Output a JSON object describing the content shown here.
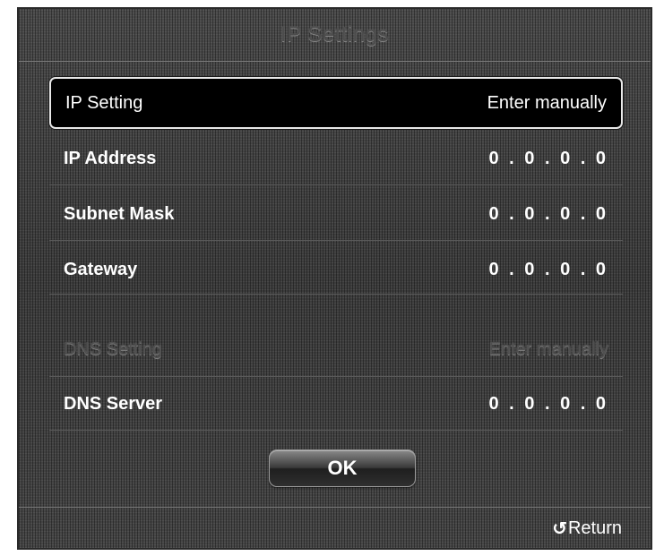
{
  "dialog": {
    "title": "IP Settings"
  },
  "settings": [
    {
      "label": "IP Setting",
      "value": "Enter manually"
    },
    {
      "label": "IP Address",
      "value": "0 . 0 . 0 . 0"
    },
    {
      "label": "Subnet Mask",
      "value": "0 . 0 . 0 . 0"
    },
    {
      "label": "Gateway",
      "value": "0 . 0 . 0 . 0"
    },
    {
      "label": "DNS Setting",
      "value": "Enter manually"
    },
    {
      "label": "DNS Server",
      "value": "0 . 0 . 0 . 0"
    }
  ],
  "ok_button": {
    "label": "OK"
  },
  "footer": {
    "return_icon": "return-arrow-icon",
    "return_glyph": "↺",
    "return_label": "Return"
  }
}
